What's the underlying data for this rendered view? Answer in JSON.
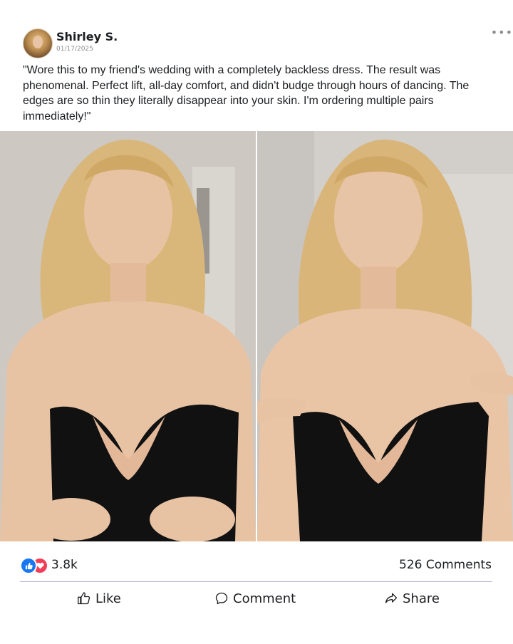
{
  "post": {
    "author": "Shirley S.",
    "date": "01/17/2025",
    "text": "\"Wore this to my friend's wedding with a completely backless dress. The result was phenomenal. Perfect lift, all-day comfort, and didn't budge through hours of dancing. The edges are so thin they literally disappear into your skin. I'm ordering multiple pairs immediately!\"",
    "more_icon": "more-horizontal-icon"
  },
  "photos": [
    {
      "name": "photo-left",
      "description_icon": "image"
    },
    {
      "name": "photo-right",
      "description_icon": "image"
    }
  ],
  "reactions": {
    "icons": [
      "like-reaction-icon",
      "love-reaction-icon"
    ],
    "count": "3.8k",
    "comments": "526 Comments"
  },
  "actions": {
    "like": "Like",
    "comment": "Comment",
    "share": "Share"
  },
  "colors": {
    "like_blue": "#1877f2",
    "love_red": "#f33e58",
    "divider": "#b9b2d6"
  }
}
